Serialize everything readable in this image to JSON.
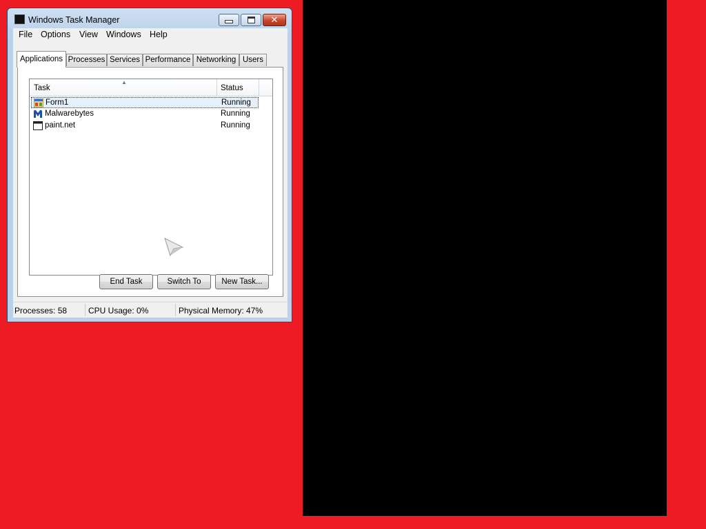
{
  "window": {
    "title": "Windows Task Manager"
  },
  "menu": [
    "File",
    "Options",
    "View",
    "Windows",
    "Help"
  ],
  "tabs": [
    "Applications",
    "Processes",
    "Services",
    "Performance",
    "Networking",
    "Users"
  ],
  "active_tab": "Applications",
  "list": {
    "columns": [
      "Task",
      "Status"
    ],
    "rows": [
      {
        "task": "Form1",
        "status": "Running",
        "icon": "form-app-icon",
        "selected": true
      },
      {
        "task": "Malwarebytes",
        "status": "Running",
        "icon": "malwarebytes-icon",
        "selected": false
      },
      {
        "task": "paint.net",
        "status": "Running",
        "icon": "generic-window-icon",
        "selected": false
      }
    ]
  },
  "buttons": {
    "end_task": "End Task",
    "switch_to": "Switch To",
    "new_task": "New Task..."
  },
  "statusbar": {
    "processes": "Processes: 58",
    "cpu": "CPU Usage: 0%",
    "memory": "Physical Memory: 47%"
  },
  "colors": {
    "background": "#ED1C24",
    "panel": "#000000",
    "close_button": "#C7462C"
  }
}
